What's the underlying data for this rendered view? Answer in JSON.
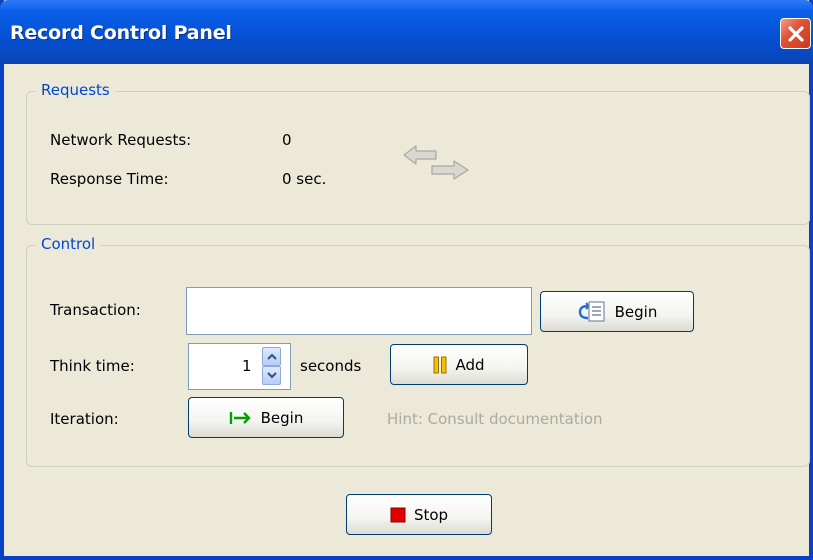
{
  "window": {
    "title": "Record Control Panel"
  },
  "requests": {
    "legend": "Requests",
    "network_requests_label": "Network Requests:",
    "network_requests_value": "0",
    "response_time_label": "Response Time:",
    "response_time_value": "0 sec."
  },
  "control": {
    "legend": "Control",
    "transaction_label": "Transaction:",
    "transaction_value": "",
    "transaction_begin_label": "Begin",
    "think_time_label": "Think time:",
    "think_time_value": "1",
    "think_time_unit": "seconds",
    "add_label": "Add",
    "iteration_label": "Iteration:",
    "iteration_begin_label": "Begin",
    "hint": "Hint: Consult documentation"
  },
  "footer": {
    "stop_label": "Stop"
  },
  "colors": {
    "titlebar": "#0651d6",
    "legend_text": "#0046d5",
    "stop_square": "#e00000",
    "iteration_arrow": "#00a000",
    "pause_bars": "#e8b000"
  },
  "icons": {
    "close": "close-icon",
    "network": "network-arrows-icon",
    "transaction": "transaction-icon",
    "add": "pause-icon",
    "iteration": "iteration-arrow-icon",
    "stop": "stop-icon"
  }
}
